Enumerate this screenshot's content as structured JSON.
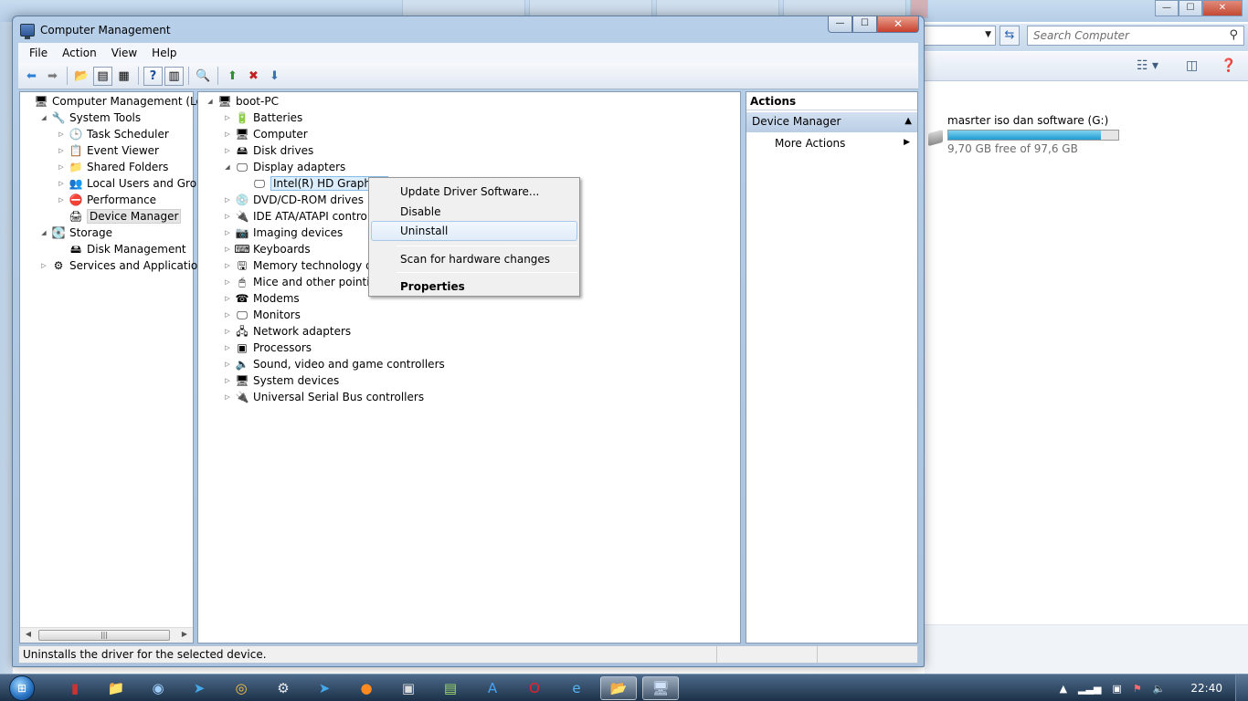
{
  "background": {
    "search_placeholder": "Search Computer",
    "drive": {
      "name": "masrter iso dan software (G:)",
      "free_text": "9,70 GB free of 97,6 GB",
      "used_fraction": 0.9
    }
  },
  "window": {
    "title": "Computer Management",
    "minimize": "—",
    "maximize": "☐",
    "close": "✕"
  },
  "menu": [
    "File",
    "Action",
    "View",
    "Help"
  ],
  "left_tree": [
    {
      "label": "Computer Management (Local",
      "icon": "computer-management-icon",
      "glyph": "🖥",
      "indent": 0,
      "twisty": ""
    },
    {
      "label": "System Tools",
      "icon": "tools-icon",
      "glyph": "🔧",
      "indent": 1,
      "twisty": "◢"
    },
    {
      "label": "Task Scheduler",
      "icon": "clock-icon",
      "glyph": "🕒",
      "indent": 2,
      "twisty": "▷"
    },
    {
      "label": "Event Viewer",
      "icon": "event-viewer-icon",
      "glyph": "📋",
      "indent": 2,
      "twisty": "▷"
    },
    {
      "label": "Shared Folders",
      "icon": "shared-folder-icon",
      "glyph": "📁",
      "indent": 2,
      "twisty": "▷"
    },
    {
      "label": "Local Users and Groups",
      "icon": "users-icon",
      "glyph": "👥",
      "indent": 2,
      "twisty": "▷"
    },
    {
      "label": "Performance",
      "icon": "performance-icon",
      "glyph": "⛔",
      "indent": 2,
      "twisty": "▷"
    },
    {
      "label": "Device Manager",
      "icon": "device-manager-icon",
      "glyph": "🖨",
      "indent": 2,
      "twisty": "",
      "selected": true
    },
    {
      "label": "Storage",
      "icon": "storage-icon",
      "glyph": "💽",
      "indent": 1,
      "twisty": "◢"
    },
    {
      "label": "Disk Management",
      "icon": "disk-management-icon",
      "glyph": "🖴",
      "indent": 2,
      "twisty": ""
    },
    {
      "label": "Services and Applications",
      "icon": "services-icon",
      "glyph": "⚙",
      "indent": 1,
      "twisty": "▷"
    }
  ],
  "device_tree": [
    {
      "label": "boot-PC",
      "icon": "computer-icon",
      "glyph": "🖥",
      "indent": 0,
      "twisty": "◢"
    },
    {
      "label": "Batteries",
      "icon": "battery-icon",
      "glyph": "🔋",
      "indent": 1,
      "twisty": "▷"
    },
    {
      "label": "Computer",
      "icon": "computer-icon",
      "glyph": "🖥",
      "indent": 1,
      "twisty": "▷"
    },
    {
      "label": "Disk drives",
      "icon": "disk-drive-icon",
      "glyph": "🖴",
      "indent": 1,
      "twisty": "▷"
    },
    {
      "label": "Display adapters",
      "icon": "display-adapter-icon",
      "glyph": "🖵",
      "indent": 1,
      "twisty": "◢"
    },
    {
      "label": "Intel(R) HD Graphics",
      "icon": "display-adapter-icon",
      "glyph": "🖵",
      "indent": 2,
      "twisty": "",
      "selected": true
    },
    {
      "label": "DVD/CD-ROM drives",
      "icon": "dvd-icon",
      "glyph": "💿",
      "indent": 1,
      "twisty": "▷"
    },
    {
      "label": "IDE ATA/ATAPI controll",
      "icon": "ide-controller-icon",
      "glyph": "🔌",
      "indent": 1,
      "twisty": "▷"
    },
    {
      "label": "Imaging devices",
      "icon": "camera-icon",
      "glyph": "📷",
      "indent": 1,
      "twisty": "▷"
    },
    {
      "label": "Keyboards",
      "icon": "keyboard-icon",
      "glyph": "⌨",
      "indent": 1,
      "twisty": "▷"
    },
    {
      "label": "Memory technology dri",
      "icon": "memory-icon",
      "glyph": "🖫",
      "indent": 1,
      "twisty": "▷"
    },
    {
      "label": "Mice and other pointing",
      "icon": "mouse-icon",
      "glyph": "🖱",
      "indent": 1,
      "twisty": "▷"
    },
    {
      "label": "Modems",
      "icon": "modem-icon",
      "glyph": "☎",
      "indent": 1,
      "twisty": "▷"
    },
    {
      "label": "Monitors",
      "icon": "monitor-icon",
      "glyph": "🖵",
      "indent": 1,
      "twisty": "▷"
    },
    {
      "label": "Network adapters",
      "icon": "network-icon",
      "glyph": "🖧",
      "indent": 1,
      "twisty": "▷"
    },
    {
      "label": "Processors",
      "icon": "processor-icon",
      "glyph": "▣",
      "indent": 1,
      "twisty": "▷"
    },
    {
      "label": "Sound, video and game controllers",
      "icon": "speaker-icon",
      "glyph": "🔈",
      "indent": 1,
      "twisty": "▷"
    },
    {
      "label": "System devices",
      "icon": "system-devices-icon",
      "glyph": "🖥",
      "indent": 1,
      "twisty": "▷"
    },
    {
      "label": "Universal Serial Bus controllers",
      "icon": "usb-icon",
      "glyph": "🔌",
      "indent": 1,
      "twisty": "▷"
    }
  ],
  "context_menu": {
    "update": "Update Driver Software...",
    "disable": "Disable",
    "uninstall": "Uninstall",
    "scan": "Scan for hardware changes",
    "properties": "Properties"
  },
  "actions": {
    "header": "Actions",
    "section": "Device Manager",
    "more": "More Actions"
  },
  "status": "Uninstalls the driver for the selected device.",
  "taskbar": {
    "clock": "22:40"
  },
  "colors": {
    "selection": "#dceefc",
    "accent": "#2c77c5"
  }
}
